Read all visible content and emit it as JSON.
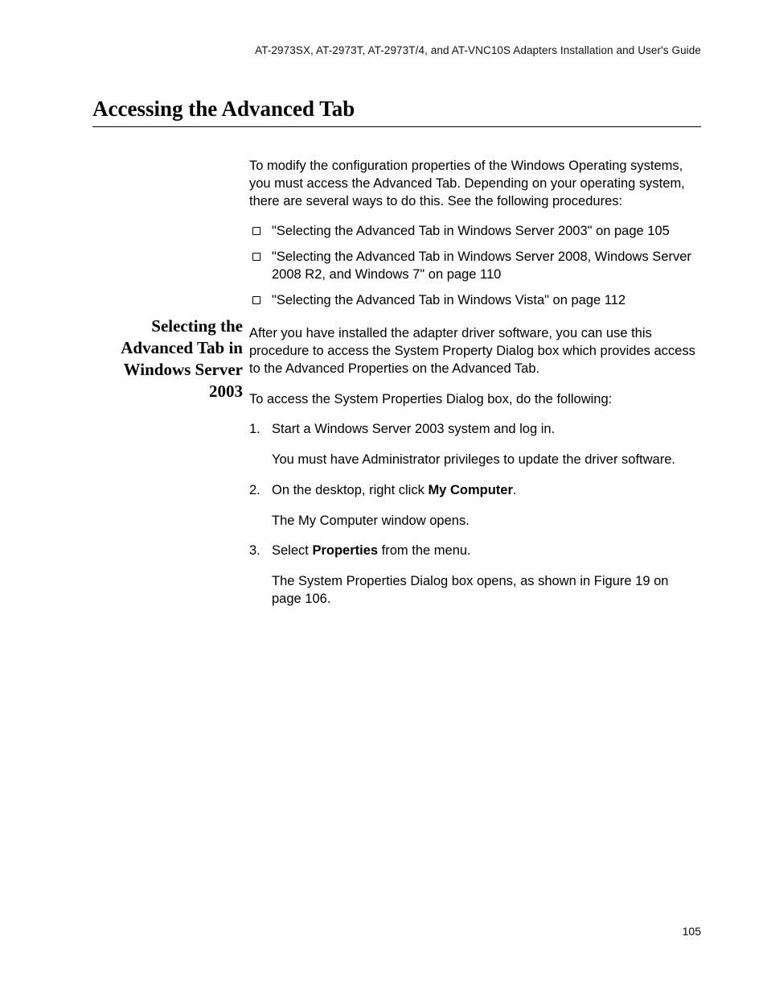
{
  "header": {
    "running": "AT-2973SX, AT-2973T, AT-2973T/4, and AT-VNC10S Adapters Installation and User's Guide"
  },
  "title": "Accessing the Advanced Tab",
  "intro": "To modify the configuration properties of the Windows Operating systems, you must access the Advanced Tab. Depending on your operating system, there are several ways to do this. See the following procedures:",
  "bullets": [
    "\"Selecting the Advanced Tab in Windows Server 2003\" on page 105",
    "\"Selecting the Advanced Tab in Windows Server 2008, Windows Server 2008 R2, and Windows 7\" on page 110",
    "\"Selecting the Advanced Tab in Windows Vista\" on page 112"
  ],
  "section": {
    "side_heading": "Selecting the Advanced Tab in Windows Server 2003",
    "lead": "After you have installed the adapter driver software, you can use this procedure to access the System Property Dialog box which provides access to the Advanced Properties on the Advanced Tab.",
    "steps_intro": "To access the System Properties Dialog box, do the following:",
    "steps": [
      {
        "num": "1.",
        "text_pre": "Start a Windows Server 2003 system and log in.",
        "sub": "You must have Administrator privileges to update the driver software."
      },
      {
        "num": "2.",
        "text_pre": "On the desktop, right click ",
        "bold": "My Computer",
        "text_post": ".",
        "sub": "The My Computer window opens."
      },
      {
        "num": "3.",
        "text_pre": "Select ",
        "bold": "Properties",
        "text_post": " from the menu.",
        "sub": "The System Properties Dialog box opens, as shown in Figure 19 on page 106."
      }
    ]
  },
  "page_number": "105"
}
